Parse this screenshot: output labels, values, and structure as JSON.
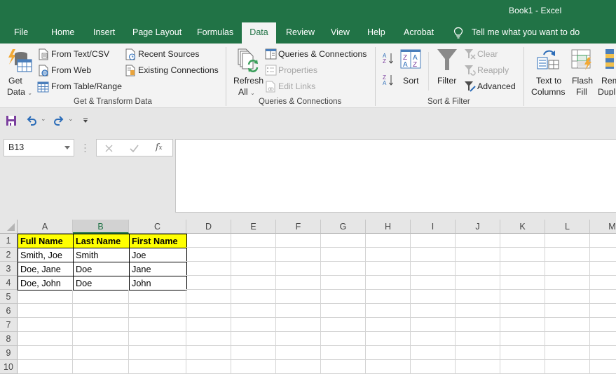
{
  "window": {
    "title": "Book1  -  Excel"
  },
  "tabs": [
    {
      "label": "File",
      "active": false
    },
    {
      "label": "Home",
      "active": false
    },
    {
      "label": "Insert",
      "active": false
    },
    {
      "label": "Page Layout",
      "active": false
    },
    {
      "label": "Formulas",
      "active": false
    },
    {
      "label": "Data",
      "active": true
    },
    {
      "label": "Review",
      "active": false
    },
    {
      "label": "View",
      "active": false
    },
    {
      "label": "Help",
      "active": false
    },
    {
      "label": "Acrobat",
      "active": false
    }
  ],
  "tell_me": {
    "placeholder": "Tell me what you want to do",
    "icon": "lightbulb-icon"
  },
  "ribbon": {
    "get_transform": {
      "group_label": "Get & Transform Data",
      "get_data": {
        "line1": "Get",
        "line2": "Data",
        "icon": "get-data-icon"
      },
      "items": [
        {
          "label": "From Text/CSV",
          "icon": "text-file-icon",
          "enabled": true
        },
        {
          "label": "From Web",
          "icon": "web-file-icon",
          "enabled": true
        },
        {
          "label": "From Table/Range",
          "icon": "table-icon",
          "enabled": true
        },
        {
          "label": "Recent Sources",
          "icon": "recent-sources-icon",
          "enabled": true
        },
        {
          "label": "Existing Connections",
          "icon": "existing-connections-icon",
          "enabled": true
        }
      ]
    },
    "queries": {
      "group_label": "Queries & Connections",
      "refresh": {
        "line1": "Refresh",
        "line2": "All",
        "icon": "refresh-all-icon"
      },
      "items": [
        {
          "label": "Queries & Connections",
          "icon": "queries-pane-icon",
          "enabled": true
        },
        {
          "label": "Properties",
          "icon": "properties-icon",
          "enabled": false
        },
        {
          "label": "Edit Links",
          "icon": "edit-links-icon",
          "enabled": false
        }
      ]
    },
    "sort_filter": {
      "group_label": "Sort & Filter",
      "sort_label": "Sort",
      "filter_label": "Filter",
      "items": [
        {
          "label": "Clear",
          "icon": "clear-filter-icon",
          "enabled": false
        },
        {
          "label": "Reapply",
          "icon": "reapply-icon",
          "enabled": false
        },
        {
          "label": "Advanced",
          "icon": "advanced-filter-icon",
          "enabled": true
        }
      ]
    },
    "data_tools": {
      "text_to_columns": {
        "line1": "Text to",
        "line2": "Columns"
      },
      "flash_fill": {
        "line1": "Flash",
        "line2": "Fill"
      },
      "remove_duplicates": {
        "line1": "Rem",
        "line2": "Dupl"
      }
    }
  },
  "formula_bar": {
    "name_box": "B13",
    "formula": ""
  },
  "sheet": {
    "columns": [
      "A",
      "B",
      "C",
      "D",
      "E",
      "F",
      "G",
      "H",
      "I",
      "J",
      "K",
      "L",
      "M"
    ],
    "selected_column": "B",
    "rows": [
      "1",
      "2",
      "3",
      "4",
      "5",
      "6",
      "7",
      "8",
      "9",
      "10"
    ],
    "cells": [
      [
        "Full Name",
        "Last Name",
        "First Name"
      ],
      [
        "Smith, Joe",
        "Smith",
        "Joe"
      ],
      [
        "Doe, Jane",
        "Doe",
        "Jane"
      ],
      [
        "Doe, John",
        "Doe",
        "John"
      ]
    ],
    "header_fill": "#ffff00"
  },
  "colors": {
    "brand": "#217346",
    "ribbon_bg": "#f3f3f3"
  }
}
